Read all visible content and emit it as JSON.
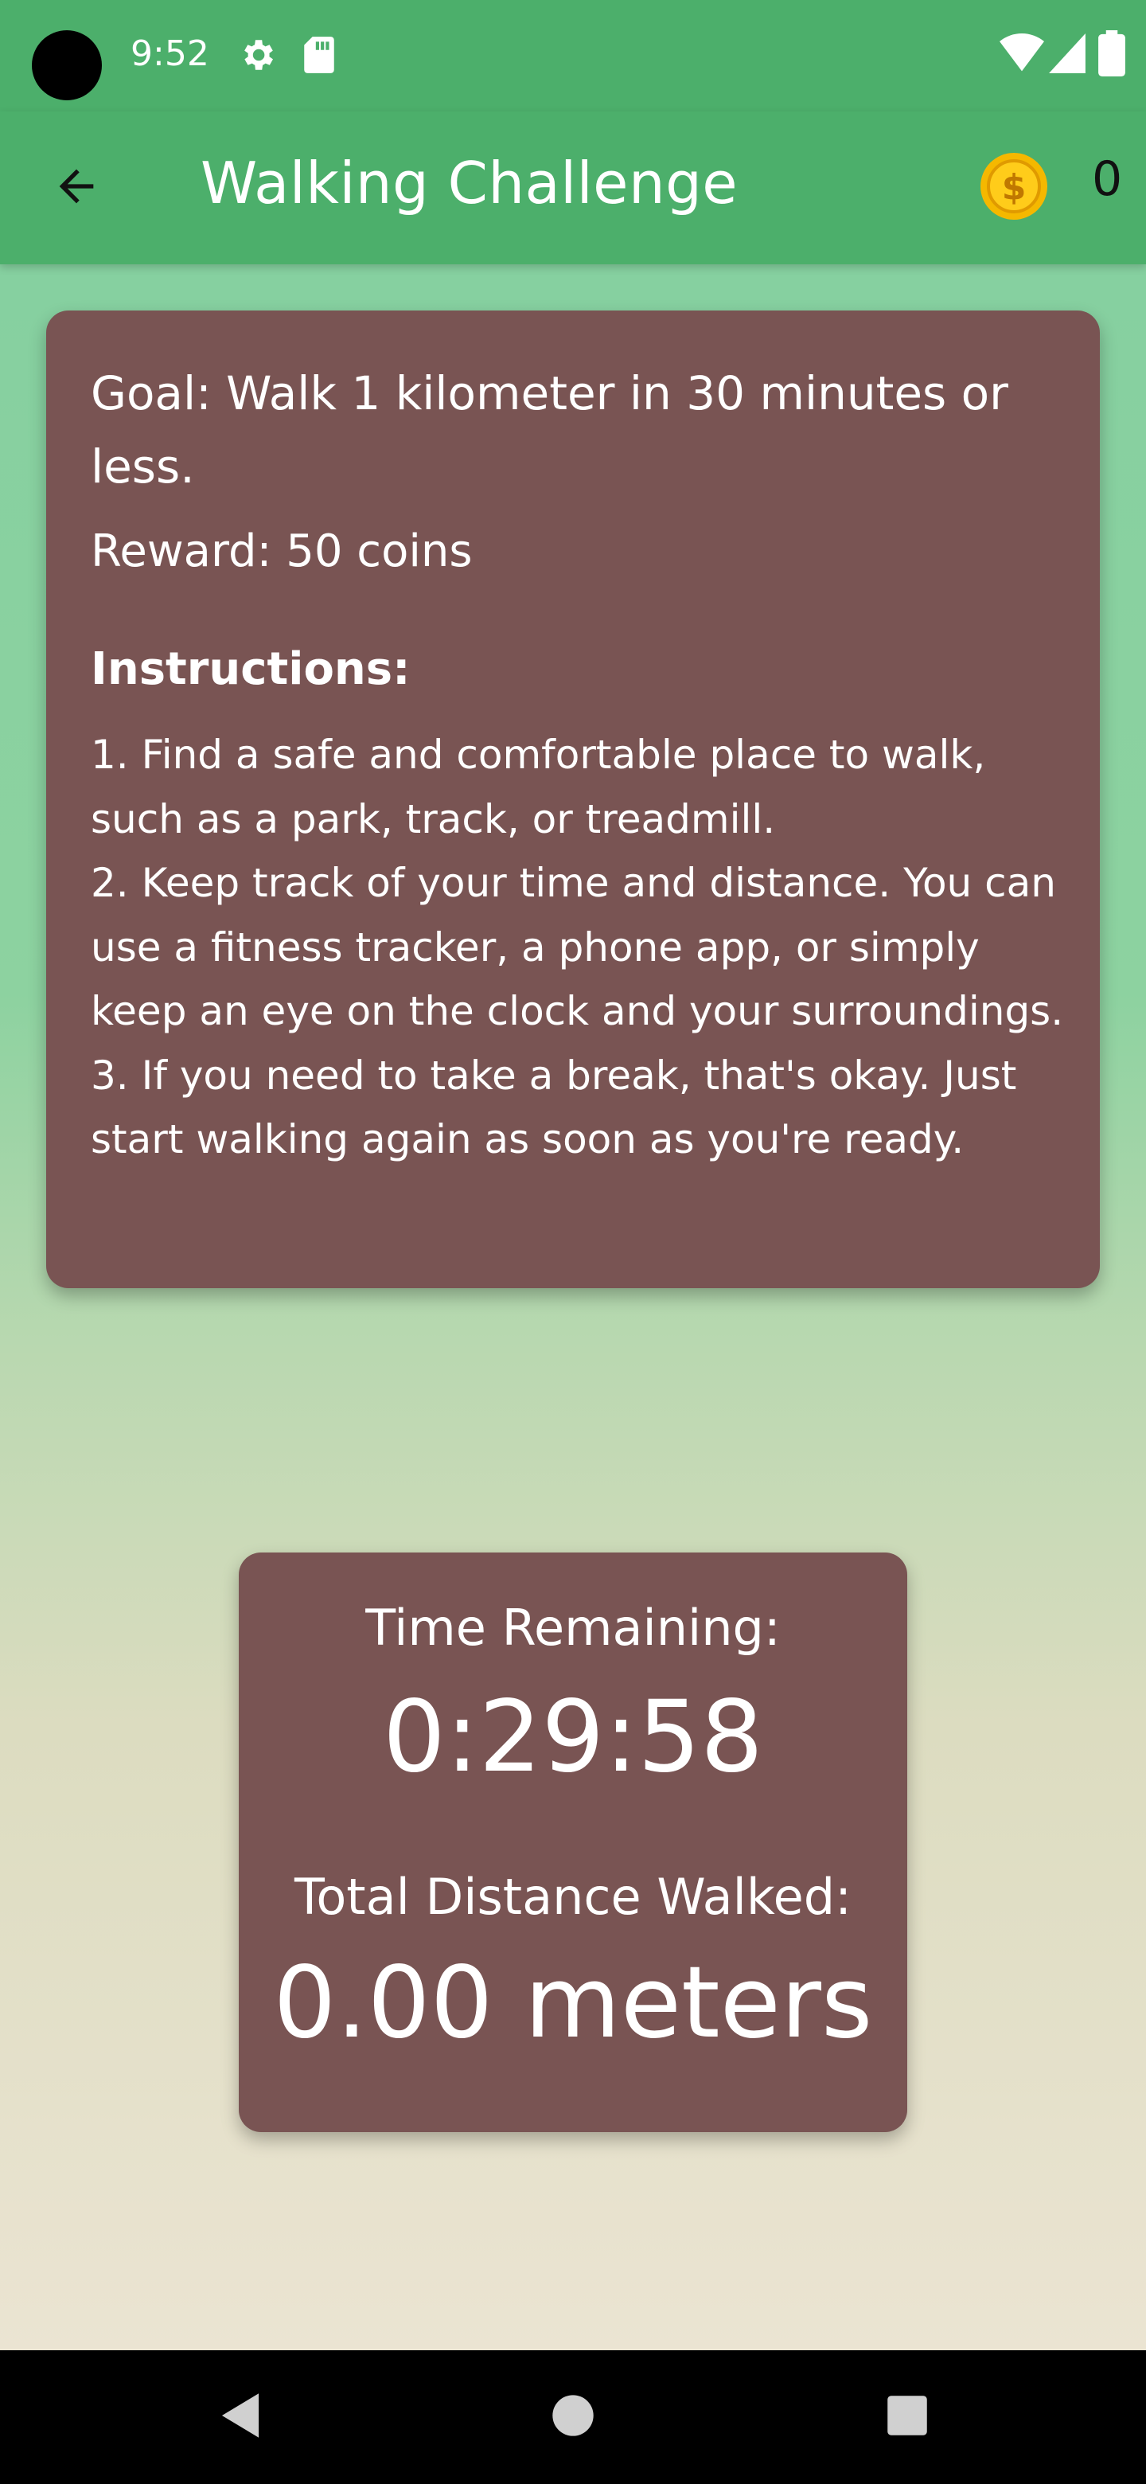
{
  "status_bar": {
    "time": "9:52",
    "icons": [
      "settings-icon",
      "sd-card-icon",
      "wifi-icon",
      "signal-icon",
      "battery-icon"
    ]
  },
  "app_bar": {
    "title": "Walking Challenge",
    "coin_count": "0",
    "icons": [
      "back-arrow-icon",
      "coin-icon"
    ]
  },
  "challenge": {
    "goal": "Goal: Walk 1 kilometer in 30 minutes or less.",
    "reward": "Reward: 50 coins",
    "instructions_heading": "Instructions:",
    "instructions": [
      "1. Find a safe and comfortable place to walk, such as a park, track, or treadmill.",
      "2. Keep track of your time and distance. You can use a fitness tracker, a phone app, or simply keep an eye on the clock and your surroundings.",
      "3. If you need to take a break, that's okay. Just start walking again as soon as you're ready."
    ]
  },
  "stats": {
    "time_label": "Time Remaining:",
    "time_value": "0:29:58",
    "distance_label": "Total Distance Walked:",
    "distance_value": "0.00 meters"
  },
  "nav_bar": {
    "icons": [
      "back-triangle-icon",
      "home-circle-icon",
      "recents-square-icon"
    ]
  },
  "colors": {
    "primary": "#4caf6b",
    "card": "#795453",
    "coin": "#f5b800"
  }
}
